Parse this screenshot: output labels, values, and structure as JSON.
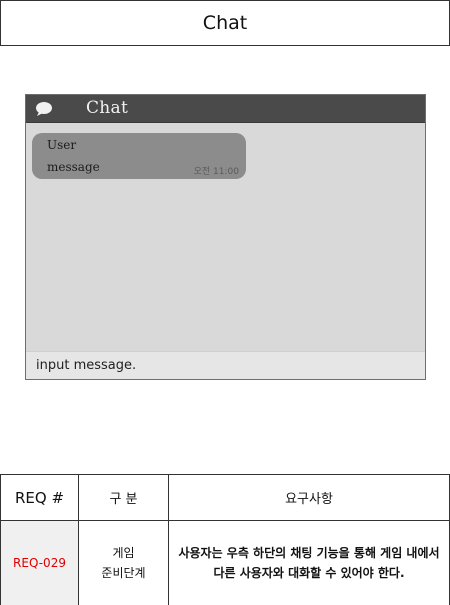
{
  "header": {
    "title": "Chat"
  },
  "chat": {
    "title": "Chat",
    "icon": "speech-bubble-icon",
    "messages": [
      {
        "sender": "User",
        "text": "message",
        "time": "오전 11:00"
      }
    ],
    "input_placeholder": "input message."
  },
  "table": {
    "headers": {
      "req": "REQ #",
      "category": "구 분",
      "requirement": "요구사항"
    },
    "rows": [
      {
        "req": "REQ-029",
        "category_line1": "게임",
        "category_line2": "준비단계",
        "requirement": "사용자는 우측 하단의 채팅 기능을 통해 게임 내에서 다른 사용자와 대화할 수 있어야 한다."
      }
    ]
  },
  "colors": {
    "title_bar": "#4a4a4a",
    "chat_bg": "#d9d9d9",
    "bubble": "#8c8c8c",
    "req_accent": "#e00000"
  }
}
